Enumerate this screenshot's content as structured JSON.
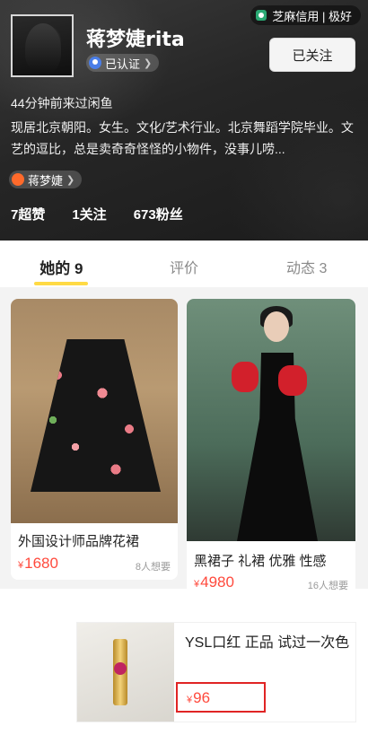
{
  "profile": {
    "credit_badge": "芝麻信用 | 极好",
    "name": "蒋梦婕rita",
    "verified_label": "已认证",
    "follow_button": "已关注",
    "last_seen": "44分钟前来过闲鱼",
    "bio": "现居北京朝阳。女生。文化/艺术行业。北京舞蹈学院毕业。文艺的逗比，总是卖奇奇怪怪的小物件，没事儿唠...",
    "tag_label": "蒋梦婕",
    "stats": {
      "likes": "7超赞",
      "following": "1关注",
      "fans": "673粉丝"
    }
  },
  "tabs": [
    {
      "label": "她的 9",
      "active": true
    },
    {
      "label": "评价",
      "active": false
    },
    {
      "label": "动态 3",
      "active": false
    }
  ],
  "items": [
    {
      "title": "外国设计师品牌花裙",
      "currency": "¥",
      "price": "1680",
      "wants": "8人想要"
    },
    {
      "title": "黑裙子 礼裙 优雅 性感",
      "currency": "¥",
      "price": "4980",
      "wants": "16人想要"
    }
  ],
  "popup_item": {
    "title": "YSL口红 正品 试过一次色",
    "currency": "¥",
    "price": "96"
  },
  "colors": {
    "accent_yellow": "#ffda44",
    "price_red": "#ff4a3d",
    "highlight_box": "#e02424"
  }
}
